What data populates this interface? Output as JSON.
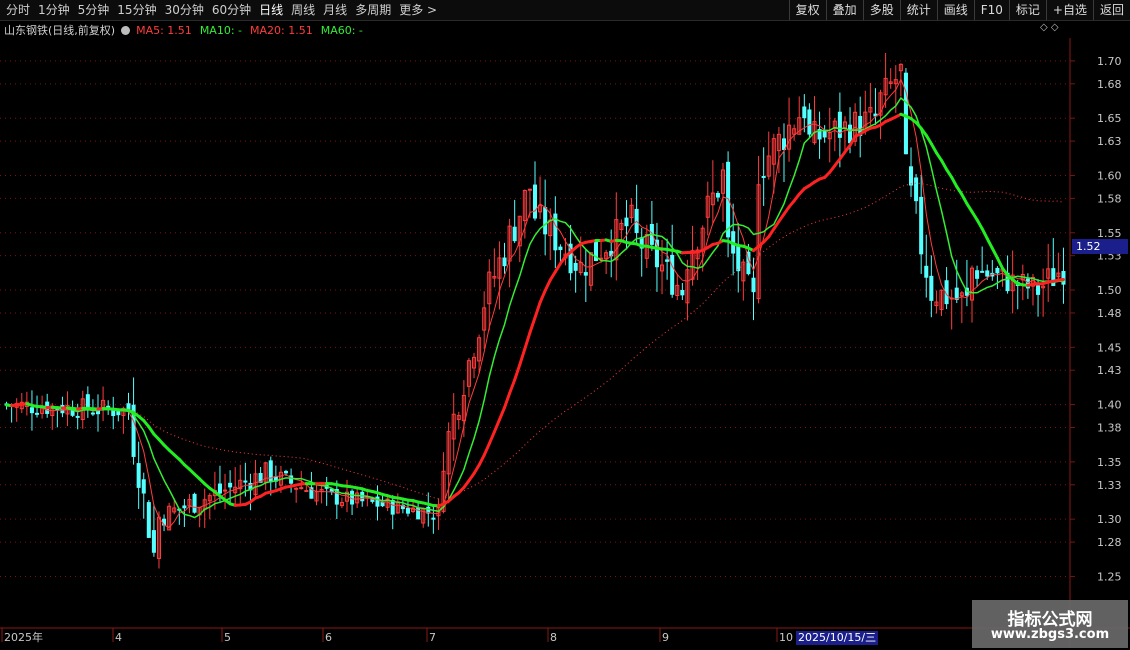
{
  "toolbar": {
    "left_items": [
      "分时",
      "1分钟",
      "5分钟",
      "15分钟",
      "30分钟",
      "60分钟",
      "日线",
      "周线",
      "月线",
      "多周期",
      "更多 >"
    ],
    "active_item": "日线",
    "right_items": [
      "复权",
      "叠加",
      "多股",
      "统计",
      "画线",
      "F10",
      "标记",
      "+自选",
      "返回"
    ]
  },
  "legend": {
    "stock_title": "山东钢铁(日线,前复权)",
    "ma5": "MA5: 1.51",
    "ma10": "MA10: -",
    "ma20": "MA20: 1.51",
    "ma60": "MA60: -",
    "colors": {
      "ma5": "#ff3c3c",
      "ma10": "#33ee33",
      "ma20": "#ff3c3c",
      "ma60": "#33ee33"
    }
  },
  "corner_icons": "◇ ◇",
  "price_tag": "1.52",
  "date_tag": "2025/10/15/三",
  "watermark": {
    "line1": "指标公式网",
    "line2": "www.zbgs3.com"
  },
  "colors": {
    "up": "#ff3c3c",
    "down": "#54ffff",
    "grid": "#7a1414",
    "axis_text": "#c8c8c8",
    "background": "#000000"
  },
  "chart_data": {
    "type": "candlestick",
    "ylim": [
      1.205,
      1.72
    ],
    "yticks": [
      "1.70",
      "1.68",
      "1.65",
      "1.63",
      "1.60",
      "1.58",
      "1.55",
      "1.53",
      "1.50",
      "1.48",
      "1.45",
      "1.43",
      "1.40",
      "1.38",
      "1.35",
      "1.33",
      "1.30",
      "1.28",
      "1.25"
    ],
    "xticks": [
      "2025年",
      "4",
      "5",
      "6",
      "7",
      "8",
      "9",
      "10"
    ],
    "last_price": 1.52,
    "candle_segments": [
      {
        "n": 25,
        "from": 1.4,
        "to": 1.395,
        "vol": 0.018
      },
      {
        "n": 5,
        "from": 1.39,
        "to": 1.27,
        "vol": 0.03
      },
      {
        "n": 22,
        "from": 1.3,
        "to": 1.34,
        "vol": 0.02
      },
      {
        "n": 12,
        "from": 1.34,
        "to": 1.32,
        "vol": 0.018
      },
      {
        "n": 22,
        "from": 1.32,
        "to": 1.305,
        "vol": 0.015
      },
      {
        "n": 8,
        "from": 1.34,
        "to": 1.47,
        "vol": 0.03
      },
      {
        "n": 10,
        "from": 1.48,
        "to": 1.59,
        "vol": 0.035
      },
      {
        "n": 10,
        "from": 1.57,
        "to": 1.52,
        "vol": 0.03
      },
      {
        "n": 10,
        "from": 1.52,
        "to": 1.56,
        "vol": 0.03
      },
      {
        "n": 10,
        "from": 1.55,
        "to": 1.5,
        "vol": 0.03
      },
      {
        "n": 8,
        "from": 1.52,
        "to": 1.6,
        "vol": 0.035
      },
      {
        "n": 6,
        "from": 1.55,
        "to": 1.49,
        "vol": 0.03
      },
      {
        "n": 10,
        "from": 1.6,
        "to": 1.66,
        "vol": 0.035
      },
      {
        "n": 14,
        "from": 1.63,
        "to": 1.65,
        "vol": 0.03
      },
      {
        "n": 5,
        "from": 1.66,
        "to": 1.69,
        "vol": 0.03
      },
      {
        "n": 5,
        "from": 1.62,
        "to": 1.52,
        "vol": 0.04
      },
      {
        "n": 8,
        "from": 1.5,
        "to": 1.49,
        "vol": 0.03
      },
      {
        "n": 14,
        "from": 1.52,
        "to": 1.5,
        "vol": 0.025
      },
      {
        "n": 5,
        "from": 1.5,
        "to": 1.52,
        "vol": 0.03
      }
    ],
    "series": [
      {
        "name": "MA5",
        "color": "#ff3c3c"
      },
      {
        "name": "MA10",
        "color": "#33ee33"
      },
      {
        "name": "MA20",
        "color": "#ff3c3c"
      },
      {
        "name": "MA60",
        "color": "#33ee33"
      }
    ]
  }
}
